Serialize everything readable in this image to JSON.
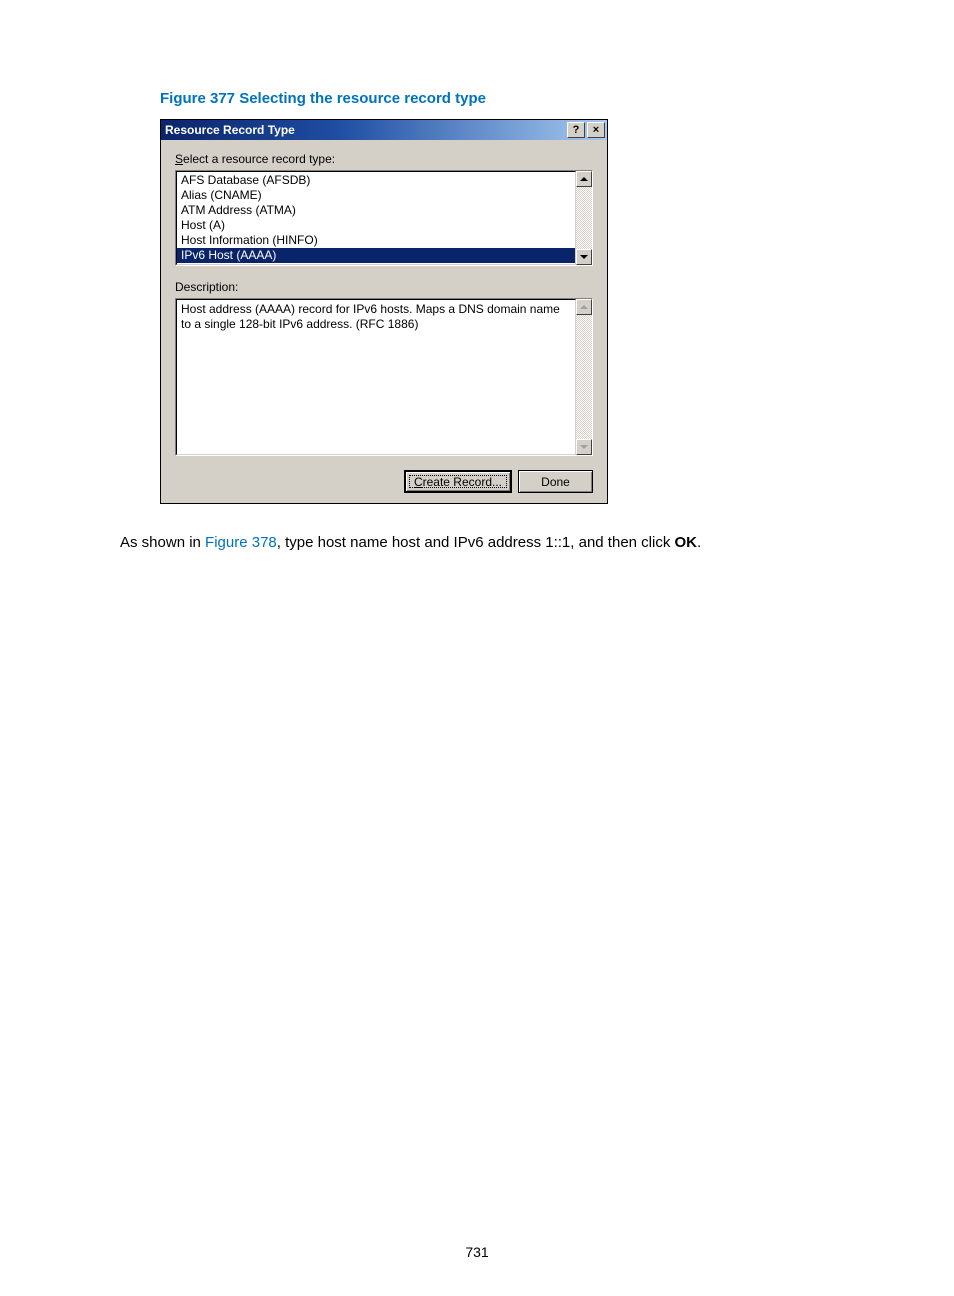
{
  "figure_caption": "Figure 377 Selecting the resource record type",
  "dialog": {
    "title": "Resource Record Type",
    "help_glyph": "?",
    "close_glyph": "×",
    "select_label_pre": "S",
    "select_label_rest": "elect a resource record type:",
    "items": [
      "AFS Database (AFSDB)",
      "Alias (CNAME)",
      "ATM Address (ATMA)",
      "Host (A)",
      "Host Information (HINFO)",
      "IPv6 Host (AAAA)"
    ],
    "selected_index": 5,
    "desc_label": "Description:",
    "desc_text": "Host address (AAAA) record for IPv6 hosts. Maps a DNS domain name to a single 128-bit IPv6 address. (RFC 1886)",
    "create_btn_pre": "C",
    "create_btn_rest": "reate Record...",
    "done_btn": "Done"
  },
  "paragraph": {
    "pre": "As shown in ",
    "link": "Figure 378",
    "mid": ", type host name host and IPv6 address 1::1, and then click ",
    "bold": "OK",
    "post": "."
  },
  "page_number": "731"
}
